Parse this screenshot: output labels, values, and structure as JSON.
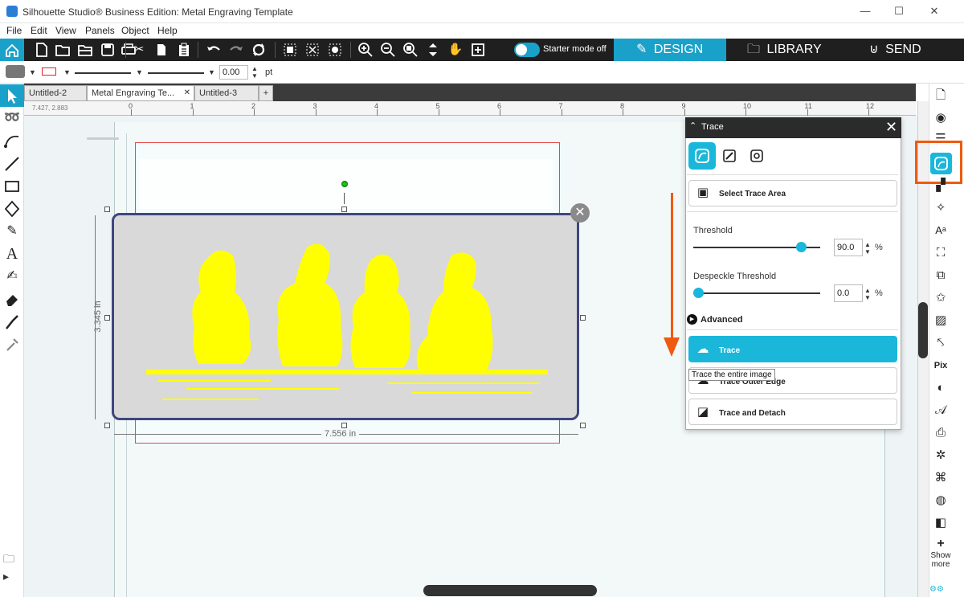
{
  "window": {
    "title": "Silhouette Studio® Business Edition: Metal Engraving Template",
    "minimize": "—",
    "maximize": "☐",
    "close": "✕"
  },
  "menu": [
    "File",
    "Edit",
    "View",
    "Panels",
    "Object",
    "Help"
  ],
  "toolbar": {
    "starter_mode_label": "Starter mode off",
    "tabs": {
      "design": "DESIGN",
      "library": "LIBRARY",
      "send": "SEND"
    },
    "icons": [
      "new-page-icon",
      "open-icon",
      "open-folder-icon",
      "save-icon",
      "print-icon",
      "cut-icon",
      "copy-icon",
      "paste-icon",
      "undo-icon",
      "redo-icon",
      "refresh-icon",
      "group-icon",
      "ungroup-icon",
      "deselect-icon",
      "zoom-in-icon",
      "zoom-out-icon",
      "zoom-selection-icon",
      "fit-to-page-icon",
      "pan-hand-icon",
      "add-page-icon"
    ]
  },
  "stylebar": {
    "line_weight": "0.00",
    "unit": "pt"
  },
  "doc_tabs": [
    {
      "label": "Untitled-2",
      "active": false
    },
    {
      "label": "Metal Engraving Te...",
      "active": true
    },
    {
      "label": "Untitled-3",
      "active": false
    }
  ],
  "doc_tab_close": "✕",
  "doc_tab_add": "+",
  "ruler": {
    "coords": "7.427, 2.883",
    "ticks": [
      "0",
      "1",
      "2",
      "3",
      "4",
      "5",
      "6",
      "7",
      "8",
      "9",
      "10",
      "11",
      "12"
    ]
  },
  "selection": {
    "height_label": "3.345 in",
    "width_label": "7.556 in"
  },
  "trace_panel": {
    "title": "Trace",
    "select_trace_area": "Select Trace Area",
    "threshold_label": "Threshold",
    "threshold_value": "90.0",
    "threshold_level": 0.9,
    "despeckle_label": "Despeckle Threshold",
    "despeckle_value": "0.0",
    "despeckle_level": 0.0,
    "percent": "%",
    "advanced_label": "Advanced",
    "trace_label": "Trace",
    "trace_outer_edge_label": "Trace Outer Edge",
    "trace_detach_label": "Trace and Detach",
    "tooltip": "Trace the entire image"
  },
  "right_panel": {
    "show_more": "Show more",
    "pix_label": "Pix"
  },
  "colors": {
    "accent": "#1ab7da",
    "toolbar_bg": "#1f1f1f",
    "annotation": "#f05a10",
    "engraving": "#ffff00",
    "page_border": "#e24a4a"
  }
}
